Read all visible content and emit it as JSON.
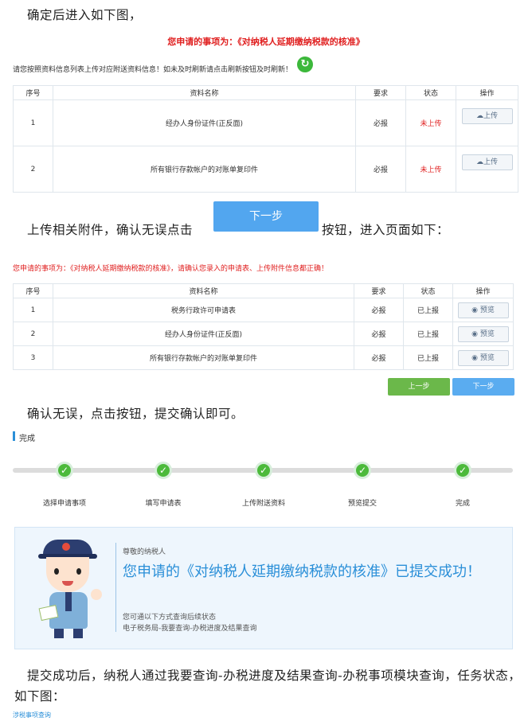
{
  "para1": "确定后进入如下图，",
  "screen1": {
    "heading": "您申请的事项为：《对纳税人延期缴纳税款的核准》",
    "notice": "请您按照资料信息列表上传对应附送资料信息！如未及时刷新请点击刷新按钮及时刷新！",
    "columns": [
      "序号",
      "资料名称",
      "要求",
      "状态",
      "操作"
    ],
    "rows": [
      {
        "no": "1",
        "name": "经办人身份证件(正反面)",
        "req": "必报",
        "status": "未上传",
        "action": "上传"
      },
      {
        "no": "2",
        "name": "所有银行存款帐户的对账单复印件",
        "req": "必报",
        "status": "未上传",
        "action": "上传"
      }
    ]
  },
  "para2_before": "上传相关附件，确认无误点击",
  "next_button": "下一步",
  "para2_after": "按钮，进入页面如下：",
  "screen2": {
    "heading": "您申请的事项为：《对纳税人延期缴纳税款的核准》，请确认您录入的申请表、上传附件信息都正确！",
    "columns": [
      "序号",
      "资料名称",
      "要求",
      "状态",
      "操作"
    ],
    "rows": [
      {
        "no": "1",
        "name": "税务行政许可申请表",
        "req": "必报",
        "status": "已上报",
        "action": "预览"
      },
      {
        "no": "2",
        "name": "经办人身份证件(正反面)",
        "req": "必报",
        "status": "已上报",
        "action": "预览"
      },
      {
        "no": "3",
        "name": "所有银行存款帐户的对账单复印件",
        "req": "必报",
        "status": "已上报",
        "action": "预览"
      }
    ],
    "prev_label": "上一步",
    "next_label": "下一步"
  },
  "para3": "确认无误，点击按钮，提交确认即可。",
  "screen3": {
    "section_title": "完成",
    "steps": [
      "选择申请事项",
      "填写申请表",
      "上传附送资料",
      "预览提交",
      "完成"
    ],
    "greeting": "尊敬的纳税人",
    "message": "您申请的《对纳税人延期缴纳税款的核准》已提交成功！",
    "hint1": "您可通以下方式查询后续状态",
    "hint2": "电子税务局-我要查询-办税进度及结果查询"
  },
  "para4": "提交成功后，纳税人通过我要查询-办税进度及结果查询-办税事项模块查询，任务状态，如下图：",
  "footer_label": "涉税事项查询",
  "colors": {
    "red": "#e02020",
    "blue": "#52a6ef",
    "green": "#4cba3b",
    "msg_blue": "#2a8fd8"
  }
}
